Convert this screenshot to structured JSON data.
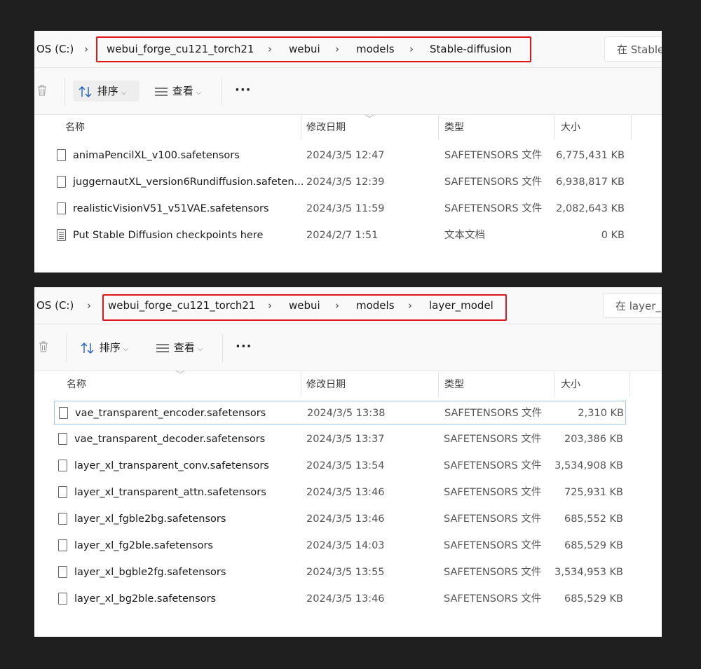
{
  "panel1": {
    "breadcrumb": [
      "OS (C:)",
      "webui_forge_cu121_torch21",
      "webui",
      "models",
      "Stable-diffusion"
    ],
    "search_placeholder": "在 Stable",
    "toolbar": {
      "sort_label": "排序",
      "view_label": "查看",
      "more_label": "···"
    },
    "columns": {
      "name": "名称",
      "date": "修改日期",
      "type": "类型",
      "size": "大小"
    },
    "files": [
      {
        "name": "animaPencilXL_v100.safetensors",
        "date": "2024/3/5 12:47",
        "type": "SAFETENSORS 文件",
        "size": "6,775,431 KB",
        "icon": "file-icon"
      },
      {
        "name": "juggernautXL_version6Rundiffusion.safeten...",
        "date": "2024/3/5 12:39",
        "type": "SAFETENSORS 文件",
        "size": "6,938,817 KB",
        "icon": "file-icon"
      },
      {
        "name": "realisticVisionV51_v51VAE.safetensors",
        "date": "2024/3/5 11:59",
        "type": "SAFETENSORS 文件",
        "size": "2,082,643 KB",
        "icon": "file-icon"
      },
      {
        "name": "Put Stable Diffusion checkpoints here",
        "date": "2024/2/7 1:51",
        "type": "文本文档",
        "size": "0 KB",
        "icon": "text-file-icon"
      }
    ]
  },
  "panel2": {
    "breadcrumb": [
      "OS (C:)",
      "webui_forge_cu121_torch21",
      "webui",
      "models",
      "layer_model"
    ],
    "search_placeholder": "在 layer_",
    "toolbar": {
      "sort_label": "排序",
      "view_label": "查看",
      "more_label": "···"
    },
    "columns": {
      "name": "名称",
      "date": "修改日期",
      "type": "类型",
      "size": "大小"
    },
    "files": [
      {
        "name": "vae_transparent_encoder.safetensors",
        "date": "2024/3/5 13:38",
        "type": "SAFETENSORS 文件",
        "size": "2,310 KB",
        "icon": "file-icon",
        "selected": true
      },
      {
        "name": "vae_transparent_decoder.safetensors",
        "date": "2024/3/5 13:37",
        "type": "SAFETENSORS 文件",
        "size": "203,386 KB",
        "icon": "file-icon"
      },
      {
        "name": "layer_xl_transparent_conv.safetensors",
        "date": "2024/3/5 13:54",
        "type": "SAFETENSORS 文件",
        "size": "3,534,908 KB",
        "icon": "file-icon"
      },
      {
        "name": "layer_xl_transparent_attn.safetensors",
        "date": "2024/3/5 13:46",
        "type": "SAFETENSORS 文件",
        "size": "725,931 KB",
        "icon": "file-icon"
      },
      {
        "name": "layer_xl_fgble2bg.safetensors",
        "date": "2024/3/5 13:46",
        "type": "SAFETENSORS 文件",
        "size": "685,552 KB",
        "icon": "file-icon"
      },
      {
        "name": "layer_xl_fg2ble.safetensors",
        "date": "2024/3/5 14:03",
        "type": "SAFETENSORS 文件",
        "size": "685,529 KB",
        "icon": "file-icon"
      },
      {
        "name": "layer_xl_bgble2fg.safetensors",
        "date": "2024/3/5 13:55",
        "type": "SAFETENSORS 文件",
        "size": "3,534,953 KB",
        "icon": "file-icon"
      },
      {
        "name": "layer_xl_bg2ble.safetensors",
        "date": "2024/3/5 13:46",
        "type": "SAFETENSORS 文件",
        "size": "685,529 KB",
        "icon": "file-icon"
      }
    ]
  },
  "colors": {
    "highlight_border": "#e0161b",
    "selection_border": "#9fc9e8",
    "background": "#1f1f1f"
  }
}
